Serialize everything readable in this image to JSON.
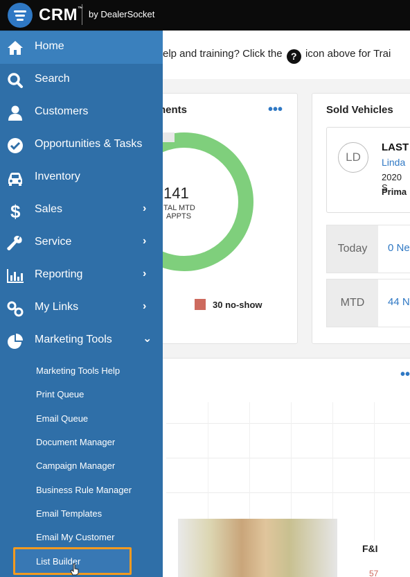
{
  "app": {
    "logo_text": "CRM",
    "logo_tm": "™",
    "logo_by": "by DealerSocket"
  },
  "help": {
    "text_before": "elp and training? Click the",
    "icon_glyph": "?",
    "text_after": "icon above for Trai"
  },
  "appointments_card": {
    "title": "nents",
    "menu_glyph": "•••",
    "total": "141",
    "total_label_1": "TAL MTD",
    "total_label_2": "APPTS",
    "legend": "30 no-show",
    "legend_color": "#cd6a5e",
    "ring_color": "#7fcf7c"
  },
  "sold_card": {
    "title": "Sold Vehicles",
    "avatar_initials": "LD",
    "last_label": "LAST",
    "customer_name": "Linda",
    "vehicle_year": "2020 S",
    "primary_label": "Prima",
    "stats": [
      {
        "label": "Today",
        "value": "0 Ne"
      },
      {
        "label": "MTD",
        "value": "44 N"
      }
    ]
  },
  "lower_card": {
    "menu_glyph": "•••",
    "column_label": "F&I",
    "partial_value": "57"
  },
  "sidebar": {
    "items": [
      {
        "label": "Home",
        "icon": "home-icon",
        "has_chevron": false
      },
      {
        "label": "Search",
        "icon": "search-icon",
        "has_chevron": false
      },
      {
        "label": "Customers",
        "icon": "user-icon",
        "has_chevron": false
      },
      {
        "label": "Opportunities & Tasks",
        "icon": "check-circle-icon",
        "has_chevron": false
      },
      {
        "label": "Inventory",
        "icon": "car-icon",
        "has_chevron": false
      },
      {
        "label": "Sales",
        "icon": "dollar-icon",
        "has_chevron": true
      },
      {
        "label": "Service",
        "icon": "wrench-icon",
        "has_chevron": true
      },
      {
        "label": "Reporting",
        "icon": "bar-chart-icon",
        "has_chevron": true
      },
      {
        "label": "My Links",
        "icon": "link-icon",
        "has_chevron": true
      },
      {
        "label": "Marketing Tools",
        "icon": "pie-chart-icon",
        "has_chevron": true
      }
    ],
    "chevron_right": "›",
    "chevron_down": "⌄",
    "submenu": [
      "Marketing Tools Help",
      "Print Queue",
      "Email Queue",
      "Document Manager",
      "Campaign Manager",
      "Business Rule Manager",
      "Email Templates",
      "Email My Customer",
      "List Builder"
    ],
    "highlight_color": "#f39a1f"
  }
}
